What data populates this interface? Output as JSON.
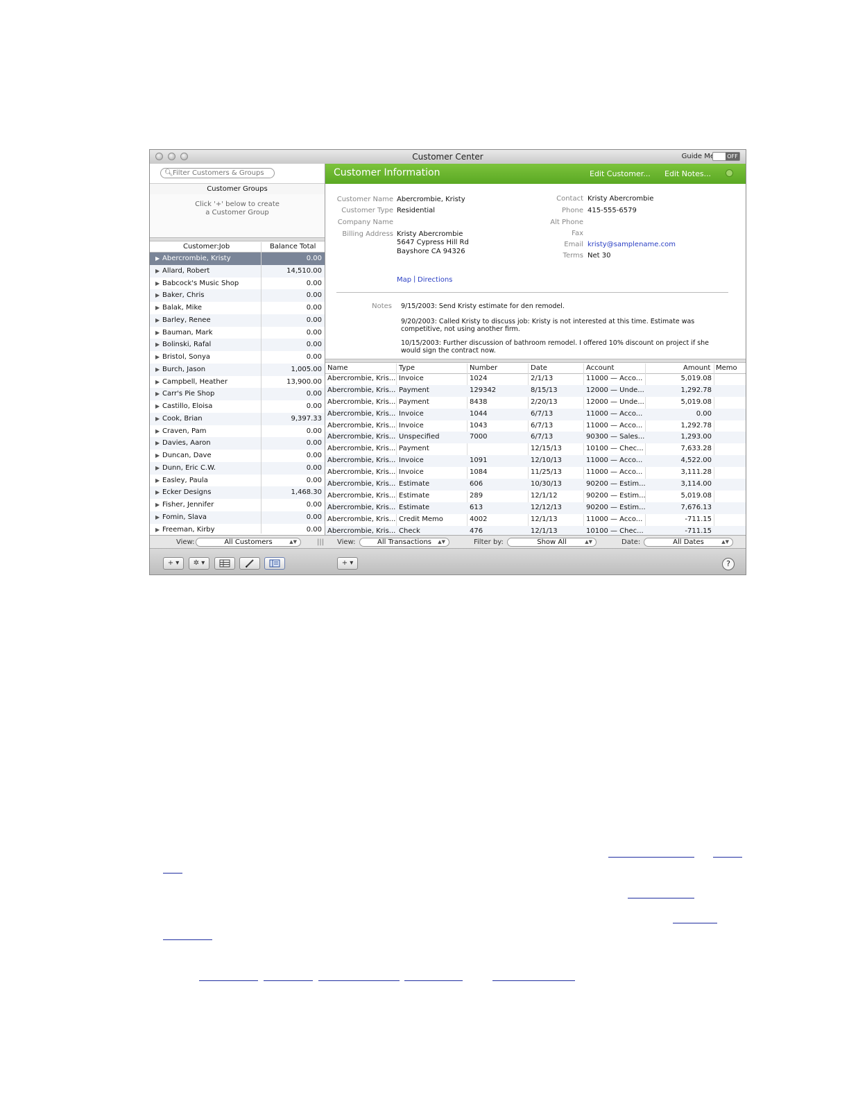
{
  "window": {
    "title": "Customer Center",
    "guide_label": "Guide Me",
    "guide_toggle": "OFF"
  },
  "search": {
    "placeholder": "Filter Customers & Groups"
  },
  "groups": {
    "header": "Customer Groups",
    "hint_line1": "Click '+' below to create",
    "hint_line2": "a Customer Group"
  },
  "customer_list": {
    "col_name": "Customer:Job",
    "col_balance": "Balance Total",
    "rows": [
      {
        "name": "Abercrombie, Kristy",
        "balance": "0.00"
      },
      {
        "name": "Allard, Robert",
        "balance": "14,510.00"
      },
      {
        "name": "Babcock's Music Shop",
        "balance": "0.00"
      },
      {
        "name": "Baker, Chris",
        "balance": "0.00"
      },
      {
        "name": "Balak, Mike",
        "balance": "0.00"
      },
      {
        "name": "Barley, Renee",
        "balance": "0.00"
      },
      {
        "name": "Bauman, Mark",
        "balance": "0.00"
      },
      {
        "name": "Bolinski, Rafal",
        "balance": "0.00"
      },
      {
        "name": "Bristol, Sonya",
        "balance": "0.00"
      },
      {
        "name": "Burch, Jason",
        "balance": "1,005.00"
      },
      {
        "name": "Campbell, Heather",
        "balance": "13,900.00"
      },
      {
        "name": "Carr's Pie Shop",
        "balance": "0.00"
      },
      {
        "name": "Castillo, Eloisa",
        "balance": "0.00"
      },
      {
        "name": "Cook, Brian",
        "balance": "9,397.33"
      },
      {
        "name": "Craven, Pam",
        "balance": "0.00"
      },
      {
        "name": "Davies, Aaron",
        "balance": "0.00"
      },
      {
        "name": "Duncan, Dave",
        "balance": "0.00"
      },
      {
        "name": "Dunn, Eric C.W.",
        "balance": "0.00"
      },
      {
        "name": "Easley, Paula",
        "balance": "0.00"
      },
      {
        "name": "Ecker Designs",
        "balance": "1,468.30"
      },
      {
        "name": "Fisher, Jennifer",
        "balance": "0.00"
      },
      {
        "name": "Fomin, Slava",
        "balance": "0.00"
      },
      {
        "name": "Freeman, Kirby",
        "balance": "0.00"
      }
    ]
  },
  "info": {
    "header": "Customer Information",
    "edit_customer": "Edit Customer...",
    "edit_notes": "Edit Notes...",
    "labels": {
      "customer_name": "Customer Name",
      "customer_type": "Customer Type",
      "company_name": "Company Name",
      "billing_address": "Billing Address",
      "contact": "Contact",
      "phone": "Phone",
      "alt_phone": "Alt Phone",
      "fax": "Fax",
      "email": "Email",
      "terms": "Terms",
      "notes": "Notes"
    },
    "values": {
      "customer_name": "Abercrombie, Kristy",
      "customer_type": "Residential",
      "billing_line1": "Kristy Abercrombie",
      "billing_line2": "5647 Cypress Hill Rd",
      "billing_line3": "Bayshore CA 94326",
      "contact": "Kristy Abercrombie",
      "phone": "415-555-6579",
      "email": "kristy@samplename.com",
      "terms": "Net 30"
    },
    "map": "Map",
    "separator": "|",
    "directions": "Directions",
    "notes": [
      "9/15/2003:  Send Kristy estimate for den remodel.",
      "9/20/2003:  Called Kristy to discuss job:  Kristy is not interested at this time.  Estimate was competitive, not using another firm.",
      "10/15/2003:  Further discussion of bathroom remodel.  I offered 10% discount on project if she would sign the contract now."
    ]
  },
  "transactions": {
    "columns": {
      "name": "Name",
      "type": "Type",
      "number": "Number",
      "date": "Date",
      "account": "Account",
      "amount": "Amount",
      "memo": "Memo"
    },
    "rows": [
      {
        "name": "Abercrombie, Kris...",
        "type": "Invoice",
        "number": "1024",
        "date": "2/1/13",
        "account": "11000 — Acco...",
        "amount": "5,019.08"
      },
      {
        "name": "Abercrombie, Kris...",
        "type": "Payment",
        "number": "129342",
        "date": "8/15/13",
        "account": "12000 — Unde...",
        "amount": "1,292.78"
      },
      {
        "name": "Abercrombie, Kris...",
        "type": "Payment",
        "number": "8438",
        "date": "2/20/13",
        "account": "12000 — Unde...",
        "amount": "5,019.08"
      },
      {
        "name": "Abercrombie, Kris...",
        "type": "Invoice",
        "number": "1044",
        "date": "6/7/13",
        "account": "11000 — Acco...",
        "amount": "0.00"
      },
      {
        "name": "Abercrombie, Kris...",
        "type": "Invoice",
        "number": "1043",
        "date": "6/7/13",
        "account": "11000 — Acco...",
        "amount": "1,292.78"
      },
      {
        "name": "Abercrombie, Kris...",
        "type": "Unspecified",
        "number": "7000",
        "date": "6/7/13",
        "account": "90300 — Sales...",
        "amount": "1,293.00"
      },
      {
        "name": "Abercrombie, Kris...",
        "type": "Payment",
        "number": "",
        "date": "12/15/13",
        "account": "10100 — Chec...",
        "amount": "7,633.28"
      },
      {
        "name": "Abercrombie, Kris...",
        "type": "Invoice",
        "number": "1091",
        "date": "12/10/13",
        "account": "11000 — Acco...",
        "amount": "4,522.00"
      },
      {
        "name": "Abercrombie, Kris...",
        "type": "Invoice",
        "number": "1084",
        "date": "11/25/13",
        "account": "11000 — Acco...",
        "amount": "3,111.28"
      },
      {
        "name": "Abercrombie, Kris...",
        "type": "Estimate",
        "number": "606",
        "date": "10/30/13",
        "account": "90200 — Estim...",
        "amount": "3,114.00"
      },
      {
        "name": "Abercrombie, Kris...",
        "type": "Estimate",
        "number": "289",
        "date": "12/1/12",
        "account": "90200 — Estim...",
        "amount": "5,019.08"
      },
      {
        "name": "Abercrombie, Kris...",
        "type": "Estimate",
        "number": "613",
        "date": "12/12/13",
        "account": "90200 — Estim...",
        "amount": "7,676.13"
      },
      {
        "name": "Abercrombie, Kris...",
        "type": "Credit Memo",
        "number": "4002",
        "date": "12/1/13",
        "account": "11000 — Acco...",
        "amount": "-711.15"
      },
      {
        "name": "Abercrombie, Kris...",
        "type": "Check",
        "number": "476",
        "date": "12/1/13",
        "account": "10100 — Chec...",
        "amount": "-711.15"
      }
    ]
  },
  "viewbar": {
    "view_label": "View:",
    "customers_view": "All Customers",
    "trans_view_label": "View:",
    "trans_view": "All Transactions",
    "filter_label": "Filter by:",
    "filter_value": "Show All",
    "date_label": "Date:",
    "date_value": "All Dates"
  },
  "toolbar": {
    "add": "+ ▾",
    "gear": "✲ ▾",
    "help": "?",
    "trans_add": "+ ▾"
  }
}
